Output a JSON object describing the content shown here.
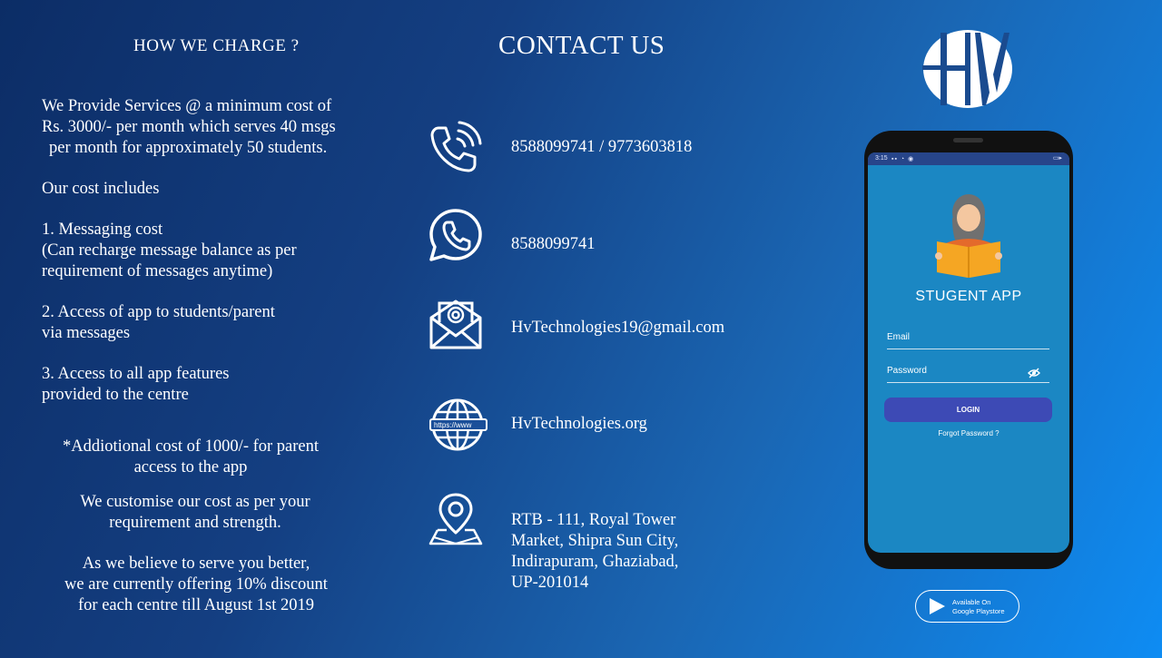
{
  "left": {
    "title": "HOW WE CHARGE ?",
    "p1": [
      "We Provide Services @ a minimum cost of",
      "Rs. 3000/- per month which serves 40 msgs",
      "per month for approximately 50 students."
    ],
    "includes": "Our cost includes",
    "item1": [
      "1. Messaging cost",
      "(Can recharge message balance as per",
      "requirement of messages anytime)"
    ],
    "item2": [
      "2. Access of app to students/parent",
      "via messages"
    ],
    "item3": [
      "3. Access to all app features",
      "provided to the centre"
    ],
    "additional": [
      "*Addiotional cost of 1000/- for parent",
      "access to the app"
    ],
    "customise": [
      "We customise our cost as per your",
      "requirement and strength."
    ],
    "offer": [
      "As we believe to serve you better,",
      "we are currently offering 10% discount",
      "for each centre till August 1st 2019"
    ]
  },
  "contact": {
    "title": "CONTACT US",
    "phone": "8588099741 / 9773603818",
    "whatsapp": "8588099741",
    "email": "HvTechnologies19@gmail.com",
    "website": "HvTechnologies.org",
    "website_badge": "https://www",
    "address": [
      "RTB - 111, Royal Tower",
      "Market, Shipra Sun City,",
      "Indirapuram, Ghaziabad,",
      "UP-201014"
    ]
  },
  "phone_mockup": {
    "status_time": "3:15",
    "app_name": "STUGENT APP",
    "email_label": "Email",
    "password_label": "Password",
    "login_label": "LOGIN",
    "forgot_label": "Forgot Password ?"
  },
  "playstore": {
    "line1": "Available On",
    "line2": "Google Playstore"
  },
  "colors": {
    "bg_dark": "#0c2d66",
    "bg_light": "#0e8cf3",
    "app_screen": "#1b87c3",
    "login_button": "#3d4ab5",
    "book": "#f5a623"
  }
}
